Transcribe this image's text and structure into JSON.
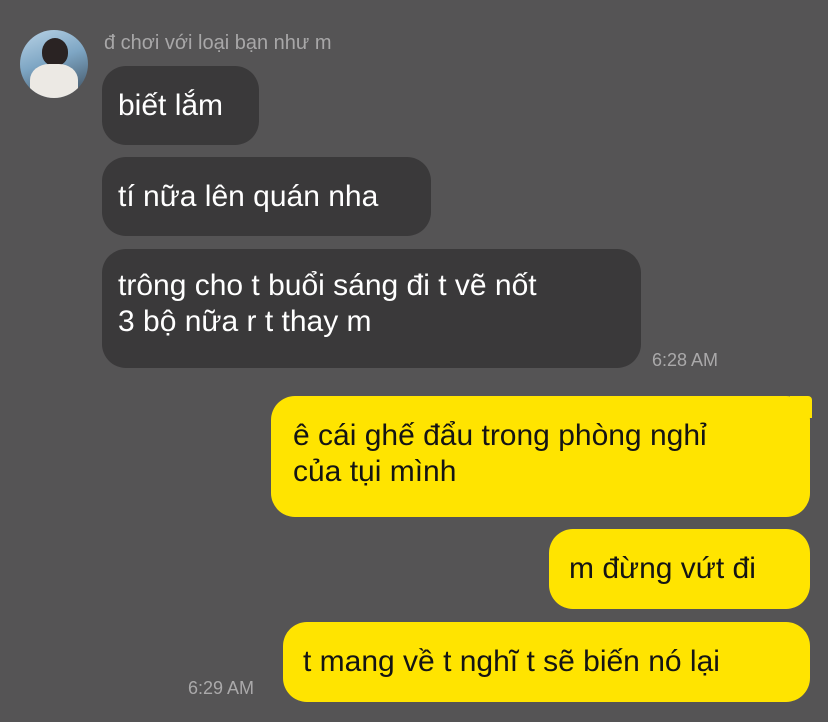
{
  "chat": {
    "sender_name": "đ chơi với loại bạn như m",
    "incoming": [
      {
        "text": "biết lắm"
      },
      {
        "text": "tí nữa lên quán nha"
      },
      {
        "line1": "trông cho t buổi sáng đi t vẽ nốt",
        "line2": "3 bộ nữa r t thay m"
      }
    ],
    "incoming_time": "6:28 AM",
    "outgoing": [
      {
        "line1": "ê cái ghế đẩu trong phòng nghỉ",
        "line2": "của tụi mình"
      },
      {
        "text": "m đừng vứt đi"
      },
      {
        "text": "t mang về t nghĩ t sẽ biến nó lại"
      }
    ],
    "outgoing_time": "6:29 AM"
  },
  "colors": {
    "background": "#555455",
    "incoming_bubble": "#3a393a",
    "outgoing_bubble": "#ffe400",
    "timestamp": "#aaa9aa"
  }
}
